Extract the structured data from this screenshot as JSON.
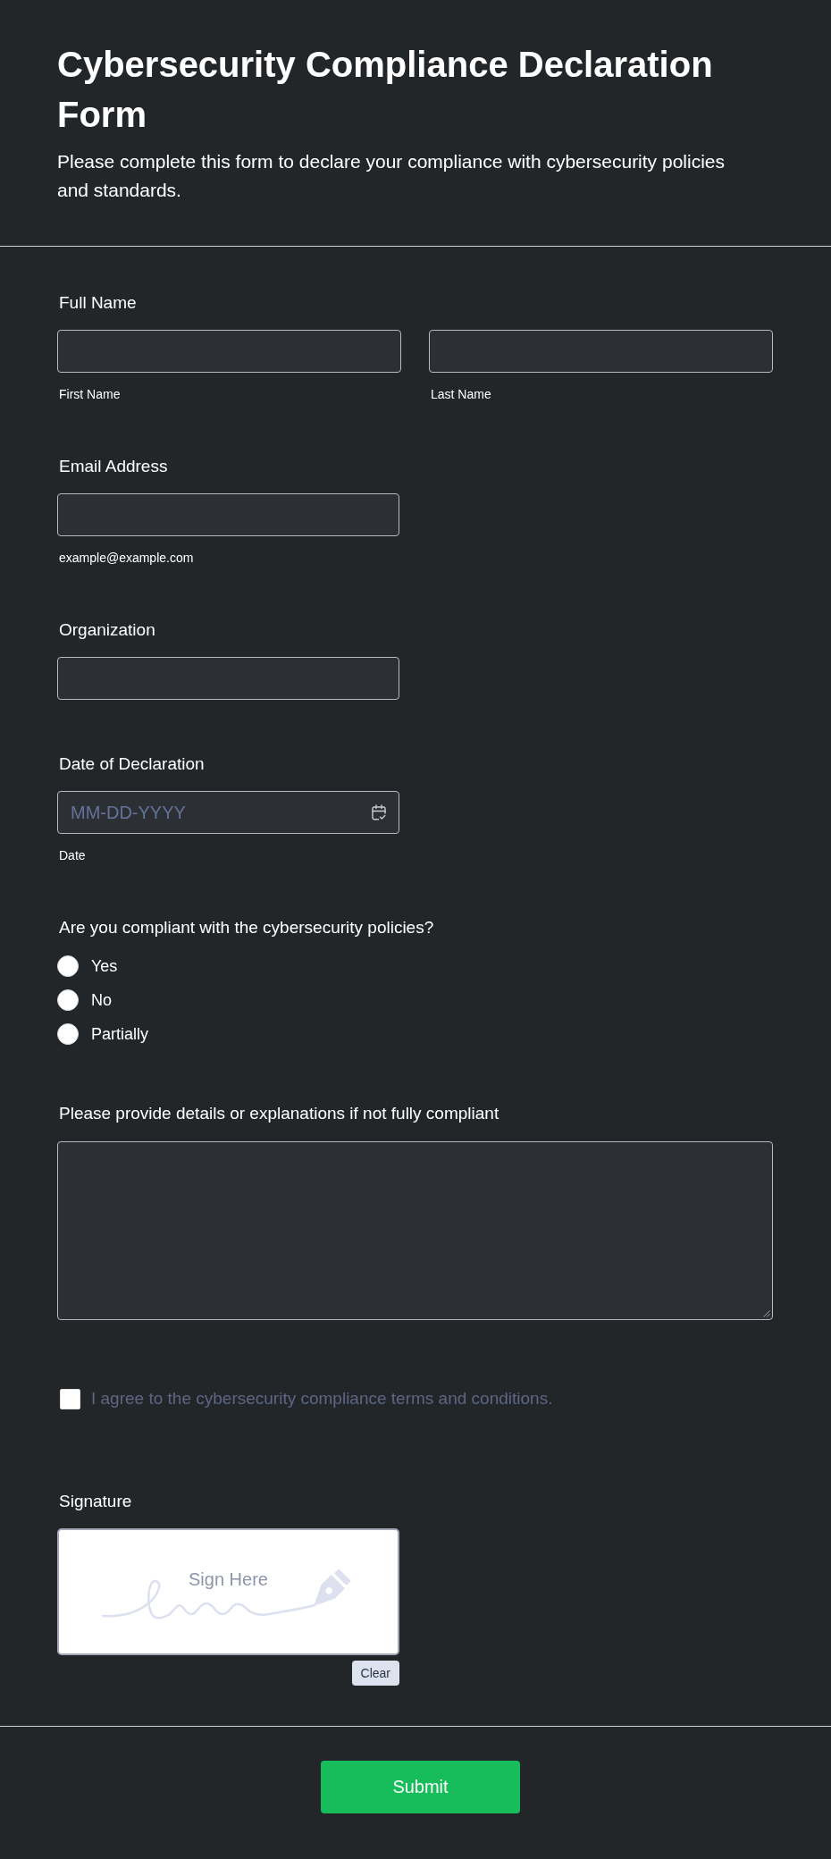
{
  "header": {
    "title": "Cybersecurity Compliance Declaration Form",
    "subtitle": "Please complete this form to declare your compliance with cybersecurity policies and standards."
  },
  "fields": [
    {
      "kind": "name",
      "label": "Full Name",
      "subfields": [
        {
          "sublabel": "First Name"
        },
        {
          "sublabel": "Last Name"
        }
      ]
    },
    {
      "kind": "text",
      "label": "Email Address",
      "sublabel": "example@example.com"
    },
    {
      "kind": "text",
      "label": "Organization"
    },
    {
      "kind": "date",
      "label": "Date of Declaration",
      "placeholder": "MM-DD-YYYY",
      "sublabel": "Date"
    },
    {
      "kind": "radio",
      "label": "Are you compliant with the cybersecurity policies?",
      "options": [
        {
          "label": "Yes",
          "selected": false
        },
        {
          "label": "No",
          "selected": false
        },
        {
          "label": "Partially",
          "selected": false
        }
      ]
    },
    {
      "kind": "textarea",
      "label": "Please provide details or explanations if not fully compliant"
    },
    {
      "kind": "checkbox",
      "label": "I agree to the cybersecurity compliance terms and conditions.",
      "checked": false
    },
    {
      "kind": "signature",
      "label": "Signature",
      "placeholder": "Sign Here",
      "clear_button": "Clear"
    }
  ],
  "submit_button": "Submit"
}
